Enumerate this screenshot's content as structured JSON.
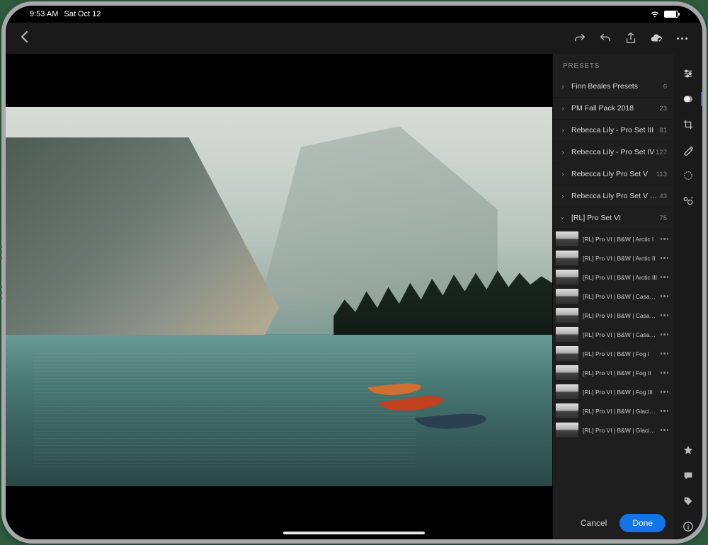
{
  "statusbar": {
    "time": "9:53 AM",
    "date": "Sat Oct 12"
  },
  "panel": {
    "title": "PRESETS",
    "groups": [
      {
        "name": "Finn Beales Presets",
        "count": "6",
        "expanded": false
      },
      {
        "name": "PM Fall Pack 2018",
        "count": "23",
        "expanded": false
      },
      {
        "name": "Rebecca Lily - Pro Set III",
        "count": "81",
        "expanded": false
      },
      {
        "name": "Rebecca Lily - Pro Set IV",
        "count": "127",
        "expanded": false
      },
      {
        "name": "Rebecca Lily Pro Set V",
        "count": "113",
        "expanded": false
      },
      {
        "name": "Rebecca Lily Pro Set V Tools",
        "count": "43",
        "expanded": false
      },
      {
        "name": "[RL] Pro Set VI",
        "count": "75",
        "expanded": true
      }
    ],
    "items": [
      {
        "name": "[RL] Pro VI | B&W | Arctic I"
      },
      {
        "name": "[RL] Pro VI | B&W | Arctic II"
      },
      {
        "name": "[RL] Pro VI | B&W | Arctic III"
      },
      {
        "name": "[RL] Pro VI | B&W | Casabl…"
      },
      {
        "name": "[RL] Pro VI | B&W | Casabl…"
      },
      {
        "name": "[RL] Pro VI | B&W | Casabl…"
      },
      {
        "name": "[RL] Pro VI | B&W | Fog I"
      },
      {
        "name": "[RL] Pro VI | B&W | Fog II"
      },
      {
        "name": "[RL] Pro VI | B&W | Fog III"
      },
      {
        "name": "[RL] Pro VI | B&W | Glacier I"
      },
      {
        "name": "[RL] Pro VI | B&W | Glacier II"
      }
    ],
    "cancel": "Cancel",
    "done": "Done"
  }
}
